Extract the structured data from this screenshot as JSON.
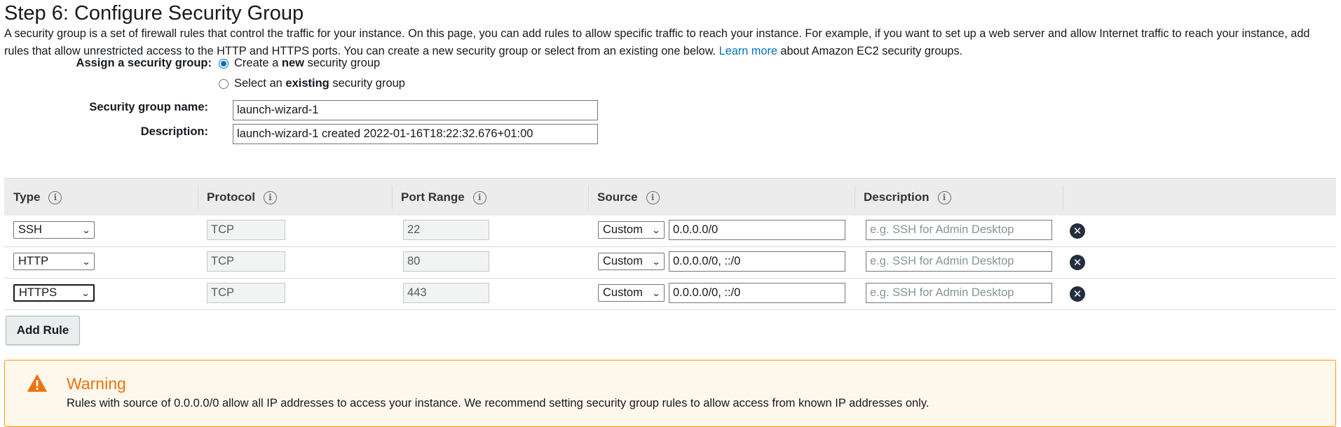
{
  "page": {
    "title": "Step 6: Configure Security Group",
    "intro_before_link": "A security group is a set of firewall rules that control the traffic for your instance. On this page, you can add rules to allow specific traffic to reach your instance. For example, if you want to set up a web server and allow Internet traffic to reach your instance, add rules that allow unrestricted access to the HTTP and HTTPS ports. You can create a new security group or select from an existing one below.",
    "intro_link": "Learn more",
    "intro_after_link": "about Amazon EC2 security groups."
  },
  "assign": {
    "label": "Assign a security group:",
    "option_new_prefix": "Create a",
    "option_new_bold": "new",
    "option_new_suffix": "security group",
    "option_existing_prefix": "Select an",
    "option_existing_bold": "existing",
    "option_existing_suffix": "security group",
    "selected": "new"
  },
  "group_name": {
    "label": "Security group name:",
    "value": "launch-wizard-1"
  },
  "group_description": {
    "label": "Description:",
    "value": "launch-wizard-1 created 2022-01-16T18:22:32.676+01:00"
  },
  "table": {
    "headers": {
      "type": "Type",
      "protocol": "Protocol",
      "port_range": "Port Range",
      "source": "Source",
      "description": "Description"
    },
    "info_glyph": "i",
    "rows": [
      {
        "type": "SSH",
        "protocol": "TCP",
        "port": "22",
        "source_type": "Custom",
        "source": "0.0.0.0/0",
        "description_placeholder": "e.g. SSH for Admin Desktop"
      },
      {
        "type": "HTTP",
        "protocol": "TCP",
        "port": "80",
        "source_type": "Custom",
        "source": "0.0.0.0/0, ::/0",
        "description_placeholder": "e.g. SSH for Admin Desktop"
      },
      {
        "type": "HTTPS",
        "protocol": "TCP",
        "port": "443",
        "source_type": "Custom",
        "source": "0.0.0.0/0, ::/0",
        "description_placeholder": "e.g. SSH for Admin Desktop"
      }
    ]
  },
  "add_rule": {
    "label": "Add Rule"
  },
  "warning": {
    "title": "Warning",
    "text": "Rules with source of 0.0.0.0/0 allow all IP addresses to access your instance. We recommend setting security group rules to allow access from known IP addresses only."
  },
  "colors": {
    "link": "#0073bb",
    "warning_border": "#ff9900",
    "warning_title": "#ec7211",
    "warning_bg": "#fef8ec"
  }
}
